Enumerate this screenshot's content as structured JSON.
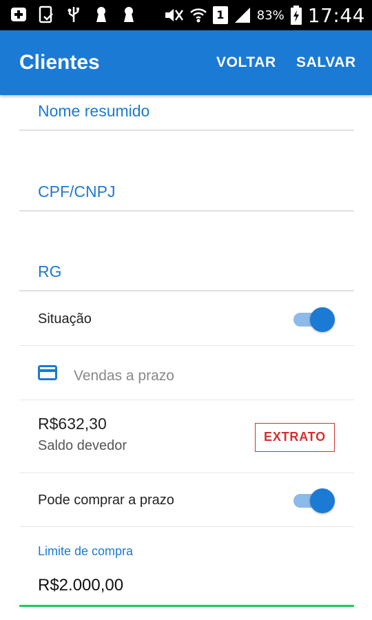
{
  "status_bar": {
    "battery_percent": "83%",
    "sim_label": "1",
    "time": "17:44",
    "icons": [
      "add-box-icon",
      "tablet-check-icon",
      "usb-icon",
      "keyhole-icon",
      "keyhole-icon",
      "mute-icon",
      "wifi-icon",
      "sim-icon",
      "signal-icon",
      "battery-charging-icon"
    ]
  },
  "appbar": {
    "title": "Clientes",
    "back_label": "VOLTAR",
    "save_label": "SALVAR",
    "color": "#1b7ad3"
  },
  "form": {
    "nome_resumido": {
      "placeholder": "Nome resumido"
    },
    "cpf_cnpj": {
      "placeholder": "CPF/CNPJ"
    },
    "rg": {
      "placeholder": "RG"
    },
    "situacao": {
      "label": "Situação",
      "enabled": true
    },
    "vendas_a_prazo": {
      "label": "Vendas a prazo",
      "icon": "credit-card-icon"
    },
    "saldo": {
      "value": "R$632,30",
      "label": "Saldo devedor",
      "extrato_label": "EXTRATO"
    },
    "pode_comprar_a_prazo": {
      "label": "Pode comprar a prazo",
      "enabled": true
    },
    "limite_de_compra": {
      "label": "Limite de compra",
      "value": "R$2.000,00"
    }
  }
}
